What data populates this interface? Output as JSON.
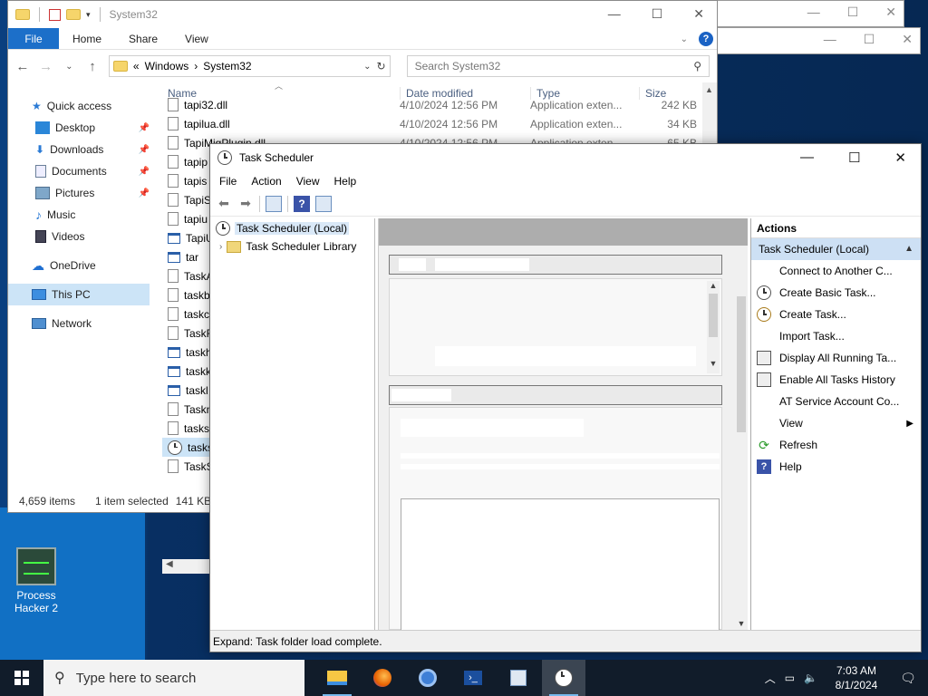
{
  "desktop": {
    "icon_label": "Process Hacker 2"
  },
  "explorer": {
    "title": "System32",
    "ribbon": {
      "file": "File",
      "home": "Home",
      "share": "Share",
      "view": "View"
    },
    "address": {
      "prefix": "«",
      "segment1": "Windows",
      "separator": "›",
      "segment2": "System32"
    },
    "search_placeholder": "Search System32",
    "nav": {
      "quick_access": "Quick access",
      "desktop": "Desktop",
      "downloads": "Downloads",
      "documents": "Documents",
      "pictures": "Pictures",
      "music": "Music",
      "videos": "Videos",
      "onedrive": "OneDrive",
      "this_pc": "This PC",
      "network": "Network"
    },
    "columns": {
      "name": "Name",
      "date": "Date modified",
      "type": "Type",
      "size": "Size"
    },
    "rows": [
      {
        "name": "tapi32.dll",
        "date": "4/10/2024 12:56 PM",
        "type": "Application exten...",
        "size": "242 KB"
      },
      {
        "name": "tapilua.dll",
        "date": "4/10/2024 12:56 PM",
        "type": "Application exten...",
        "size": "34 KB"
      },
      {
        "name": "TapiMigPlugin.dll",
        "date": "4/10/2024 12:56 PM",
        "type": "Application exten...",
        "size": "65 KB"
      },
      {
        "name": "tapip",
        "date": "",
        "type": "",
        "size": ""
      },
      {
        "name": "tapis",
        "date": "",
        "type": "",
        "size": ""
      },
      {
        "name": "TapiS",
        "date": "",
        "type": "",
        "size": ""
      },
      {
        "name": "tapiu",
        "date": "",
        "type": "",
        "size": ""
      },
      {
        "name": "TapiU",
        "date": "",
        "type": "",
        "size": ""
      },
      {
        "name": "tar",
        "date": "",
        "type": "",
        "size": ""
      },
      {
        "name": "TaskA",
        "date": "",
        "type": "",
        "size": ""
      },
      {
        "name": "taskb",
        "date": "",
        "type": "",
        "size": ""
      },
      {
        "name": "taskc",
        "date": "",
        "type": "",
        "size": ""
      },
      {
        "name": "TaskF",
        "date": "",
        "type": "",
        "size": ""
      },
      {
        "name": "taskh",
        "date": "",
        "type": "",
        "size": ""
      },
      {
        "name": "taskk",
        "date": "",
        "type": "",
        "size": ""
      },
      {
        "name": "taskl",
        "date": "",
        "type": "",
        "size": ""
      },
      {
        "name": "Taskn",
        "date": "",
        "type": "",
        "size": ""
      },
      {
        "name": "tasks",
        "date": "",
        "type": "",
        "size": ""
      },
      {
        "name": "tasks",
        "date": "",
        "type": "",
        "size": ""
      },
      {
        "name": "TaskS",
        "date": "",
        "type": "",
        "size": ""
      }
    ],
    "status": {
      "items": "4,659 items",
      "selected": "1 item selected",
      "size": "141 KB"
    }
  },
  "task_scheduler": {
    "title": "Task Scheduler",
    "menu": {
      "file": "File",
      "action": "Action",
      "view": "View",
      "help": "Help"
    },
    "tree": {
      "root": "Task Scheduler (Local)",
      "library": "Task Scheduler Library"
    },
    "actions": {
      "header": "Actions",
      "section": "Task Scheduler (Local)",
      "items": [
        "Connect to Another C...",
        "Create Basic Task...",
        "Create Task...",
        "Import Task...",
        "Display All Running Ta...",
        "Enable All Tasks History",
        "AT Service Account Co...",
        "View",
        "Refresh",
        "Help"
      ]
    },
    "status": "Expand:  Task folder load complete."
  },
  "taskbar": {
    "search_placeholder": "Type here to search",
    "time": "7:03 AM",
    "date": "8/1/2024"
  },
  "colors": {
    "accent": "#1c6fc9",
    "selection": "#cce4f7",
    "taskbar": "#111c2a"
  }
}
